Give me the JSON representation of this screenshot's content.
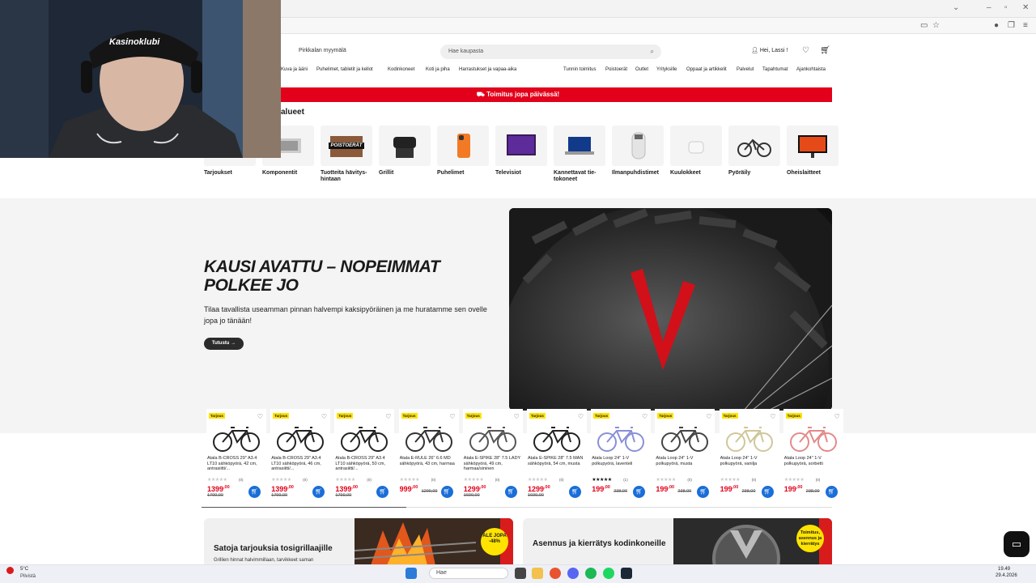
{
  "header": {
    "left_fragment": "0",
    "store": "Pirkkalan myymälä",
    "search_placeholder": "Hae kaupasta",
    "user_greeting": "Hei, Lassi !"
  },
  "nav_left": [
    "Kuva ja ääni",
    "Puhelimet, tabletit ja kellot",
    "Kodinkoneet",
    "Koti ja piha",
    "Harrastukset ja vapaa-aika"
  ],
  "nav_right": [
    "Tunnin toimitus",
    "Poistoerät",
    "Outlet",
    "Yrityksille",
    "Oppaat ja artikkelit",
    "Palvelut",
    "Tapahtumat",
    "Ajankohtaista"
  ],
  "banner": "Toimitus jopa päivässä!",
  "category_title": "alueet",
  "categories": [
    {
      "label": "Tarjoukset",
      "icon": "offers-icon"
    },
    {
      "label": "Komponentit",
      "icon": "component-icon"
    },
    {
      "label": "Tuotteita hävitys-hintaan",
      "icon": "poistoerat-icon"
    },
    {
      "label": "Grillit",
      "icon": "grill-icon"
    },
    {
      "label": "Puhelimet",
      "icon": "phone-icon"
    },
    {
      "label": "Televisiot",
      "icon": "tv-icon"
    },
    {
      "label": "Kannettavat tie-tokoneet",
      "icon": "laptop-icon"
    },
    {
      "label": "Ilmanpuhdistimet",
      "icon": "air-purifier-icon"
    },
    {
      "label": "Kuulokkeet",
      "icon": "earbuds-icon"
    },
    {
      "label": "Pyöräily",
      "icon": "bicycle-icon"
    },
    {
      "label": "Oheislaitteet",
      "icon": "monitor-icon"
    }
  ],
  "poistoerat_text": "POISTOERÄT",
  "hero": {
    "title": "KAUSI AVATTU – NOPEIMMAT POLKEE JO",
    "text": "Tilaa tavallista useamman pinnan halvempi kaksipyöräinen ja me huratamme sen ovelle jopa jo tänään!",
    "button": "Tutustu →"
  },
  "products": [
    {
      "tag": "Tarjous",
      "name": "Atala B-CROSS 29\" A3.4 LT10 sähköpyörä, 42 cm, antrasiitti/...",
      "price": "1399",
      "cents": ",00",
      "old": "1799,00",
      "rating_count": "(0)",
      "rated": false,
      "color": "#222"
    },
    {
      "tag": "Tarjous",
      "name": "Atala B-CROSS 29\" A3.4 LT10 sähköpyörä, 46 cm, antrasiitti/...",
      "price": "1399",
      "cents": ",00",
      "old": "1799,00",
      "rating_count": "(0)",
      "rated": false,
      "color": "#222"
    },
    {
      "tag": "Tarjous",
      "name": "Atala B-CROSS 29\" A3.4 LT10 sähköpyörä, 50 cm, antrasiitti/...",
      "price": "1399",
      "cents": ",00",
      "old": "1799,00",
      "rating_count": "(0)",
      "rated": false,
      "color": "#222"
    },
    {
      "tag": "Tarjous",
      "name": "Atala E-RULE 26\" 6.6 MD sähköpyörä, 43 cm, harmaa",
      "price": "999",
      "cents": ",00",
      "old": "1299,00",
      "rating_count": "(0)",
      "rated": false,
      "color": "#333"
    },
    {
      "tag": "Tarjous",
      "name": "Atala E-SPIKE 28\" 7.5 LADY sähköpyörä, 49 cm, harmaa/sininen",
      "price": "1299",
      "cents": ",00",
      "old": "1699,00",
      "rating_count": "(0)",
      "rated": false,
      "color": "#555"
    },
    {
      "tag": "Tarjous",
      "name": "Atala E-SPIKE 28\" 7.5 MAN sähköpyörä, 54 cm, musta",
      "price": "1299",
      "cents": ",00",
      "old": "1699,00",
      "rating_count": "(0)",
      "rated": false,
      "color": "#222"
    },
    {
      "tag": "Tarjous",
      "name": "Atala Loop 24\" 1-V polkupyörä, laventeli",
      "price": "199",
      "cents": ",00",
      "old": "238,00",
      "rating_count": "(1)",
      "rated": true,
      "color": "#8a8fd6"
    },
    {
      "tag": "Tarjous",
      "name": "Atala Loop 24\" 1-V polkupyörä, musta",
      "price": "199",
      "cents": ",00",
      "old": "238,00",
      "rating_count": "(0)",
      "rated": false,
      "color": "#444"
    },
    {
      "tag": "Tarjous",
      "name": "Atala Loop 24\" 1-V polkupyörä, vanilja",
      "price": "199",
      "cents": ",00",
      "old": "238,00",
      "rating_count": "(0)",
      "rated": false,
      "color": "#cfc79a"
    },
    {
      "tag": "Tarjous",
      "name": "Atala Loop 24\" 1-V polkupyörä, sorbetti",
      "price": "199",
      "cents": ",00",
      "old": "238,00",
      "rating_count": "(0)",
      "rated": false,
      "color": "#e28a8a"
    }
  ],
  "promos": [
    {
      "title": "Satoja tarjouksia tosigrillaajille",
      "sub": "Grillien hinnat halvimmillaan, tarvikkeet saman",
      "badge": "ALE JOPA -48%"
    },
    {
      "title": "Asennus ja kierrätys kodinkoneille",
      "sub": "",
      "badge": "Toimitus, asennus ja kierrätys"
    }
  ],
  "webcam_cap_text": "Kasinoklubi",
  "taskbar": {
    "weather_temp": "5°C",
    "weather_text": "Pilvistä",
    "search": "Hae",
    "time": "19.49",
    "date": "29.4.2026"
  },
  "colors": {
    "brand_red": "#e2001a",
    "cart_blue": "#1a6ed8",
    "tag_yellow": "#ffe300"
  }
}
